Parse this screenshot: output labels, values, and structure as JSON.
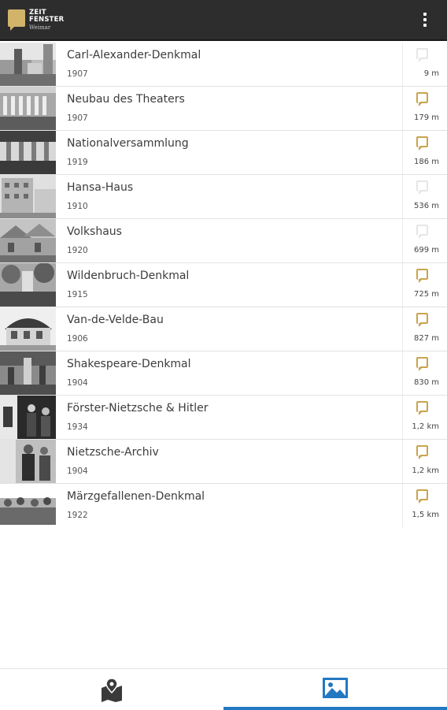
{
  "app": {
    "logo_line1": "ZEIT",
    "logo_line2": "FENSTER",
    "logo_line3": "Weimar",
    "menu_icon": "overflow-menu-icon"
  },
  "colors": {
    "appbar": "#2d2d2d",
    "accent_gold": "#c9a44e",
    "tab_indicator": "#2378c2"
  },
  "places": [
    {
      "title": "Carl-Alexander-Denkmal",
      "year": "1907",
      "distance": "9 m",
      "icon": "speech-bubble-icon",
      "visited": false
    },
    {
      "title": "Neubau des Theaters",
      "year": "1907",
      "distance": "179 m",
      "icon": "speech-bubble-icon",
      "visited": true
    },
    {
      "title": "Nationalversammlung",
      "year": "1919",
      "distance": "186 m",
      "icon": "speech-bubble-icon",
      "visited": true
    },
    {
      "title": "Hansa-Haus",
      "year": "1910",
      "distance": "536 m",
      "icon": "speech-bubble-icon",
      "visited": false
    },
    {
      "title": "Volkshaus",
      "year": "1920",
      "distance": "699 m",
      "icon": "speech-bubble-icon",
      "visited": false
    },
    {
      "title": "Wildenbruch-Denkmal",
      "year": "1915",
      "distance": "725 m",
      "icon": "speech-bubble-icon",
      "visited": true
    },
    {
      "title": "Van-de-Velde-Bau",
      "year": "1906",
      "distance": "827 m",
      "icon": "speech-bubble-icon",
      "visited": true
    },
    {
      "title": "Shakespeare-Denkmal",
      "year": "1904",
      "distance": "830 m",
      "icon": "speech-bubble-icon",
      "visited": true
    },
    {
      "title": "Förster-Nietzsche & Hitler",
      "year": "1934",
      "distance": "1,2 km",
      "icon": "speech-bubble-icon",
      "visited": true
    },
    {
      "title": "Nietzsche-Archiv",
      "year": "1904",
      "distance": "1,2 km",
      "icon": "speech-bubble-icon",
      "visited": true
    },
    {
      "title": "Märzgefallenen-Denkmal",
      "year": "1922",
      "distance": "1,5 km",
      "icon": "speech-bubble-icon",
      "visited": true
    }
  ],
  "bottom_tabs": [
    {
      "name": "map",
      "icon": "map-pin-icon",
      "selected": false
    },
    {
      "name": "photos",
      "icon": "image-gallery-icon",
      "selected": true
    }
  ]
}
